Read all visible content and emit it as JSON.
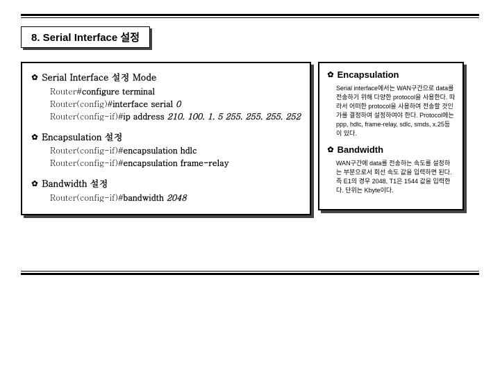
{
  "title": "8.  Serial Interface 설정",
  "left": {
    "sec1": {
      "head": "Serial Interface 설정 Mode",
      "l1_a": "Router#",
      "l1_b": "configure terminal",
      "l2_a": "Router(config)#",
      "l2_b": "interface serial ",
      "l2_c": "0",
      "l3_a": "Router(config-if)#",
      "l3_b": "ip address ",
      "l3_c": "210. 100. 1. 5 255. 255. 255. 252"
    },
    "sec2": {
      "head": "Encapsulation 설정",
      "l1_a": "Router(config-if)#",
      "l1_b": "encapsulation hdlc",
      "l2_a": "Router(config-if)#",
      "l2_b": "encapsulation frame-relay"
    },
    "sec3": {
      "head": "Bandwidth 설정",
      "l1_a": "Router(config-if)#",
      "l1_b": "bandwidth ",
      "l1_c": "2048"
    }
  },
  "right": {
    "h1": "Encapsulation",
    "b1": "Serial interface에서는 WAN구간으로 data를 전송하기 위해 다양한 protocol을 사용한다. 따라서 어떠한 protocol을 사용하여 전송할 것인가를 결정하여 설정하여야 한다. Protocol에는 ppp, hdlc, frame-relay, sdlc, smds, x.25등이 있다.",
    "h2": "Bandwidth",
    "b2": "WAN구간에 data를 전송하는 속도를 설정하는 부분으로서 회선 속도 값을 입력하면 된다. 즉 E1의 경우 2048, T1은 1544 값을 입력한다. 단위는 Kbyte이다."
  },
  "glyph": {
    "star": "✿"
  }
}
